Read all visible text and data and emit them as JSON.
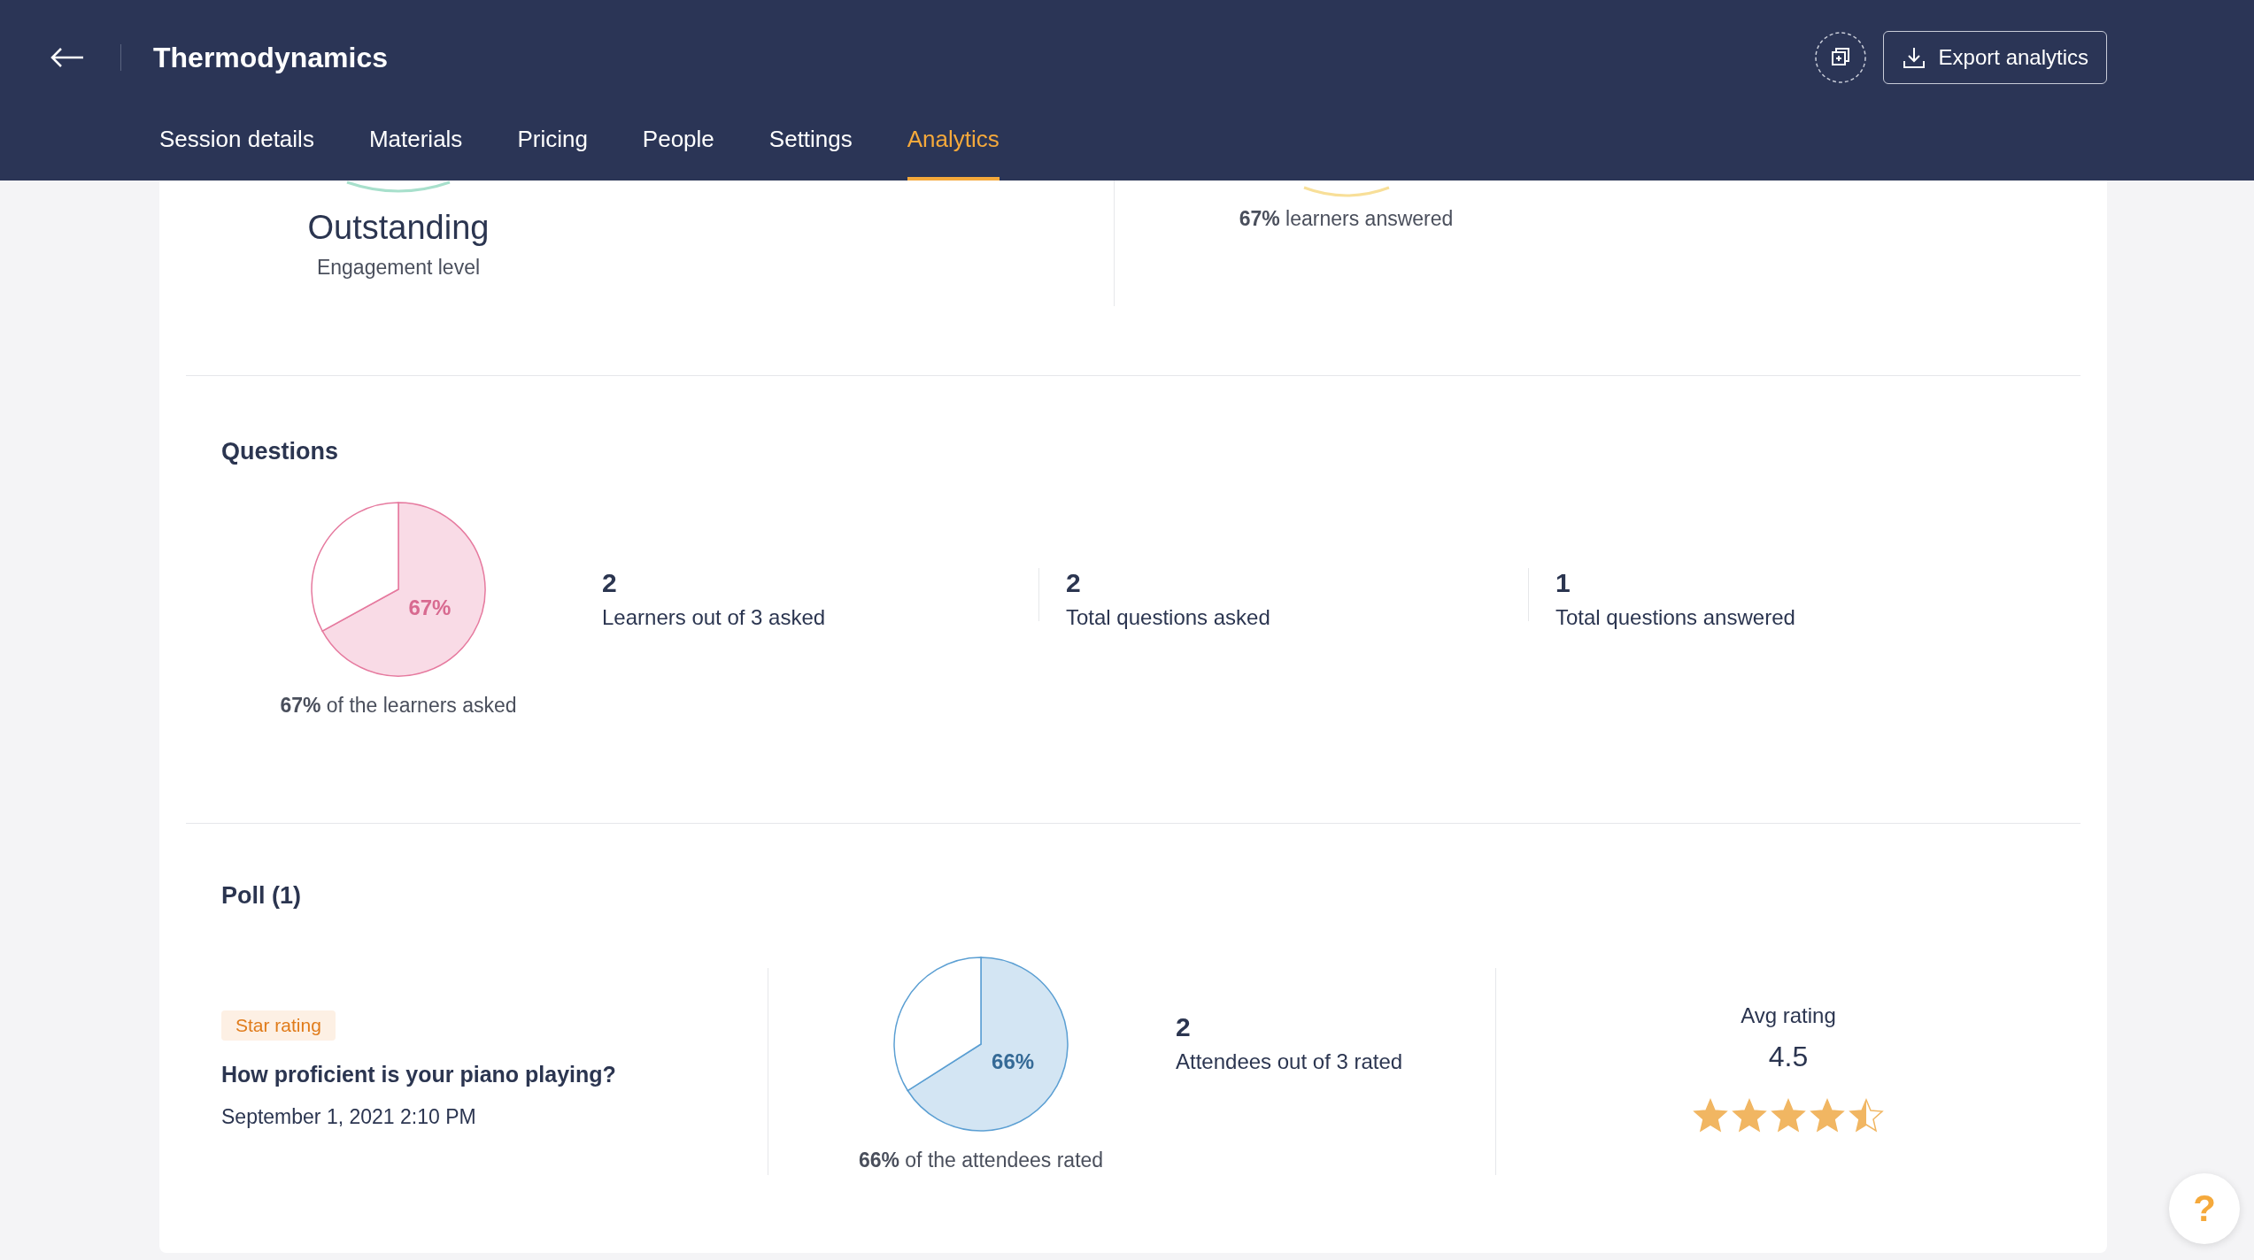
{
  "header": {
    "title": "Thermodynamics",
    "export_button": "Export analytics"
  },
  "tabs": [
    {
      "label": "Session details",
      "selected": false
    },
    {
      "label": "Materials",
      "selected": false
    },
    {
      "label": "Pricing",
      "selected": false
    },
    {
      "label": "People",
      "selected": false
    },
    {
      "label": "Settings",
      "selected": false
    },
    {
      "label": "Analytics",
      "selected": true
    }
  ],
  "engagement": {
    "value": "Outstanding",
    "label": "Engagement level",
    "answered_pct": "67%",
    "answered_text": "learners answered"
  },
  "questions": {
    "title": "Questions",
    "chart_data": {
      "type": "pie",
      "values": [
        67,
        33
      ],
      "value_labels": [
        "67%",
        null
      ]
    },
    "caption_pct": "67%",
    "caption_text": "of the learners asked",
    "stats": [
      {
        "value": "2",
        "label": "Learners out of 3 asked"
      },
      {
        "value": "2",
        "label": "Total questions asked"
      },
      {
        "value": "1",
        "label": "Total questions answered"
      }
    ]
  },
  "poll": {
    "title": "Poll (1)",
    "badge": "Star rating",
    "question": "How proficient is your piano playing?",
    "date": "September 1, 2021 2:10 PM",
    "chart_data": {
      "type": "pie",
      "values": [
        66,
        34
      ],
      "value_labels": [
        "66%",
        null
      ]
    },
    "caption_pct": "66%",
    "caption_text": "of the attendees rated",
    "stat": {
      "value": "2",
      "label": "Attendees out of 3 rated"
    },
    "avg_label": "Avg rating",
    "avg_value": "4.5",
    "stars": 4.5
  },
  "help": "?"
}
